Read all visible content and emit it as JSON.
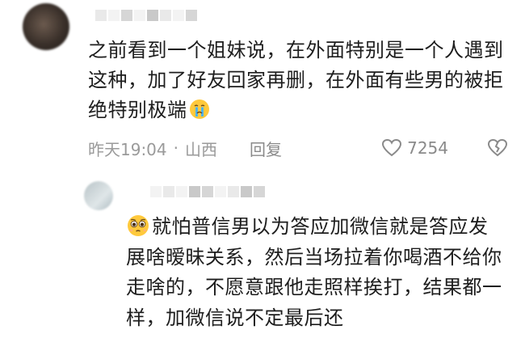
{
  "comment": {
    "text": "之前看到一个姐妹说，在外面特别是一个人遇到这种，加了好友回家再删，在外面有些男的被拒绝特别极端",
    "emoji": "crying-face-icon",
    "time": "昨天19:04",
    "location": "山西",
    "reply_label": "回复",
    "likes": "7254"
  },
  "reply": {
    "emoji": "pleading-face-icon",
    "text": "就怕普信男以为答应加微信就是答应发展啥暧昧关系，然后当场拉着你喝酒不给你走啥的，不愿意跟他走照样挨打，结果都一样，加微信说不定最后还"
  },
  "colors": {
    "text": "#1d1d1d",
    "meta": "#9a9a9a",
    "emoji_yellow": "#ffc93c",
    "tear_blue": "#4fb3f0"
  }
}
